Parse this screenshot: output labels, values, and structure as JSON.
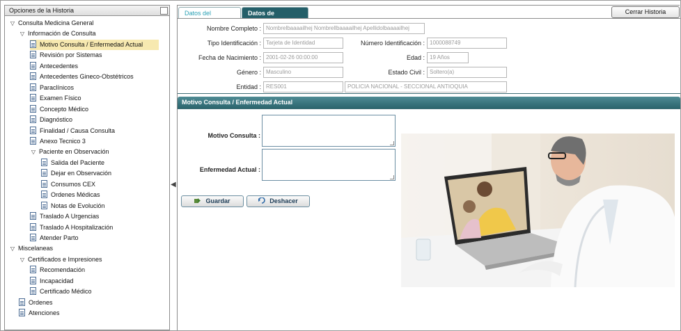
{
  "sidebar": {
    "title": "Opciones de la Historia",
    "items": [
      {
        "label": "Consulta Medicina General",
        "type": "folder",
        "level": 0
      },
      {
        "label": "Información de Consulta",
        "type": "folder",
        "level": 1
      },
      {
        "label": "Motivo Consulta / Enfermedad Actual",
        "type": "doc",
        "level": 2,
        "selected": true
      },
      {
        "label": "Revisión por Sistemas",
        "type": "doc",
        "level": 2
      },
      {
        "label": "Antecedentes",
        "type": "doc",
        "level": 2
      },
      {
        "label": "Antecedentes Gineco-Obstétricos",
        "type": "doc",
        "level": 2
      },
      {
        "label": "Paraclínicos",
        "type": "doc",
        "level": 2
      },
      {
        "label": "Examen Físico",
        "type": "doc",
        "level": 2
      },
      {
        "label": "Concepto Médico",
        "type": "doc",
        "level": 2
      },
      {
        "label": "Diagnóstico",
        "type": "doc",
        "level": 2
      },
      {
        "label": "Finalidad / Causa Consulta",
        "type": "doc",
        "level": 2
      },
      {
        "label": "Anexo Tecnico 3",
        "type": "doc",
        "level": 2
      },
      {
        "label": "Paciente en Observación",
        "type": "folder",
        "level": 2
      },
      {
        "label": "Salida del Paciente",
        "type": "doc",
        "level": 3
      },
      {
        "label": "Dejar en Observación",
        "type": "doc",
        "level": 3
      },
      {
        "label": "Consumos CEX",
        "type": "doc",
        "level": 3
      },
      {
        "label": "Ordenes Médicas",
        "type": "doc",
        "level": 3
      },
      {
        "label": "Notas de Evolución",
        "type": "doc",
        "level": 3
      },
      {
        "label": "Traslado A Urgencias",
        "type": "doc",
        "level": 2
      },
      {
        "label": "Traslado A Hospitalización",
        "type": "doc",
        "level": 2
      },
      {
        "label": "Atender Parto",
        "type": "doc",
        "level": 2
      },
      {
        "label": "Miscelaneas",
        "type": "folder",
        "level": 0
      },
      {
        "label": "Certificados e Impresiones",
        "type": "folder",
        "level": 1
      },
      {
        "label": "Recomendación",
        "type": "doc",
        "level": 2
      },
      {
        "label": "Incapacidad",
        "type": "doc",
        "level": 2
      },
      {
        "label": "Certificado Médico",
        "type": "doc",
        "level": 2
      },
      {
        "label": "Ordenes",
        "type": "doc",
        "level": 1
      },
      {
        "label": "Atenciones",
        "type": "doc",
        "level": 1
      }
    ]
  },
  "tabs": {
    "paciente": "Datos del Paciente",
    "atencion": "Datos de Atención"
  },
  "close_button": "Cerrar Historia",
  "patient": {
    "nombre_label": "Nombre Completo :",
    "nombre_value": "Nombrelbaaaailhej Nombrellbaaaailhej Apellidolbaaaailhej",
    "tipo_id_label": "Tipo Identificación :",
    "tipo_id_value": "Tarjeta de Identidad",
    "numero_id_label": "Número Identificación :",
    "numero_id_value": "1000088749",
    "nacimiento_label": "Fecha de Nacimiento :",
    "nacimiento_value": "2001-02-26 00:00:00",
    "edad_label": "Edad :",
    "edad_value": "19 Años",
    "genero_label": "Género :",
    "genero_value": "Masculino",
    "estado_civil_label": "Estado Civil :",
    "estado_civil_value": "Soltero(a)",
    "entidad_label": "Entidad :",
    "entidad_code": "RES001",
    "entidad_name": "POLICIA NACIONAL - SECCIONAL ANTIOQUIA"
  },
  "section": {
    "title": "Motivo Consulta / Enfermedad Actual",
    "motivo_label": "Motivo Consulta :",
    "motivo_value": "",
    "enfermedad_label": "Enfermedad Actual :",
    "enfermedad_value": "",
    "save_label": "Guardar",
    "undo_label": "Deshacer"
  },
  "colors": {
    "accent_dark": "#245f69",
    "accent_light": "#2aa0b4",
    "selected_bg": "#f7e9b0"
  }
}
